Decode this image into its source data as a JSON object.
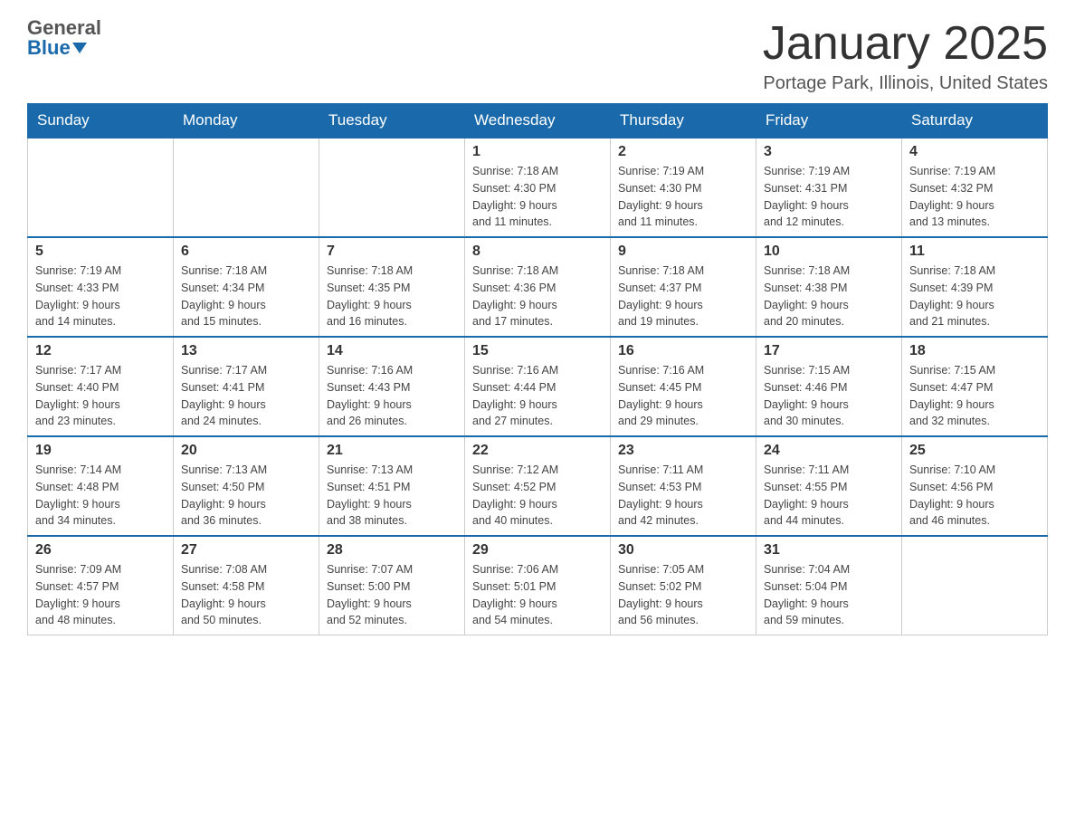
{
  "header": {
    "logo_general": "General",
    "logo_blue": "Blue",
    "month_title": "January 2025",
    "location": "Portage Park, Illinois, United States"
  },
  "days_of_week": [
    "Sunday",
    "Monday",
    "Tuesday",
    "Wednesday",
    "Thursday",
    "Friday",
    "Saturday"
  ],
  "weeks": [
    [
      {
        "day": "",
        "info": ""
      },
      {
        "day": "",
        "info": ""
      },
      {
        "day": "",
        "info": ""
      },
      {
        "day": "1",
        "info": "Sunrise: 7:18 AM\nSunset: 4:30 PM\nDaylight: 9 hours\nand 11 minutes."
      },
      {
        "day": "2",
        "info": "Sunrise: 7:19 AM\nSunset: 4:30 PM\nDaylight: 9 hours\nand 11 minutes."
      },
      {
        "day": "3",
        "info": "Sunrise: 7:19 AM\nSunset: 4:31 PM\nDaylight: 9 hours\nand 12 minutes."
      },
      {
        "day": "4",
        "info": "Sunrise: 7:19 AM\nSunset: 4:32 PM\nDaylight: 9 hours\nand 13 minutes."
      }
    ],
    [
      {
        "day": "5",
        "info": "Sunrise: 7:19 AM\nSunset: 4:33 PM\nDaylight: 9 hours\nand 14 minutes."
      },
      {
        "day": "6",
        "info": "Sunrise: 7:18 AM\nSunset: 4:34 PM\nDaylight: 9 hours\nand 15 minutes."
      },
      {
        "day": "7",
        "info": "Sunrise: 7:18 AM\nSunset: 4:35 PM\nDaylight: 9 hours\nand 16 minutes."
      },
      {
        "day": "8",
        "info": "Sunrise: 7:18 AM\nSunset: 4:36 PM\nDaylight: 9 hours\nand 17 minutes."
      },
      {
        "day": "9",
        "info": "Sunrise: 7:18 AM\nSunset: 4:37 PM\nDaylight: 9 hours\nand 19 minutes."
      },
      {
        "day": "10",
        "info": "Sunrise: 7:18 AM\nSunset: 4:38 PM\nDaylight: 9 hours\nand 20 minutes."
      },
      {
        "day": "11",
        "info": "Sunrise: 7:18 AM\nSunset: 4:39 PM\nDaylight: 9 hours\nand 21 minutes."
      }
    ],
    [
      {
        "day": "12",
        "info": "Sunrise: 7:17 AM\nSunset: 4:40 PM\nDaylight: 9 hours\nand 23 minutes."
      },
      {
        "day": "13",
        "info": "Sunrise: 7:17 AM\nSunset: 4:41 PM\nDaylight: 9 hours\nand 24 minutes."
      },
      {
        "day": "14",
        "info": "Sunrise: 7:16 AM\nSunset: 4:43 PM\nDaylight: 9 hours\nand 26 minutes."
      },
      {
        "day": "15",
        "info": "Sunrise: 7:16 AM\nSunset: 4:44 PM\nDaylight: 9 hours\nand 27 minutes."
      },
      {
        "day": "16",
        "info": "Sunrise: 7:16 AM\nSunset: 4:45 PM\nDaylight: 9 hours\nand 29 minutes."
      },
      {
        "day": "17",
        "info": "Sunrise: 7:15 AM\nSunset: 4:46 PM\nDaylight: 9 hours\nand 30 minutes."
      },
      {
        "day": "18",
        "info": "Sunrise: 7:15 AM\nSunset: 4:47 PM\nDaylight: 9 hours\nand 32 minutes."
      }
    ],
    [
      {
        "day": "19",
        "info": "Sunrise: 7:14 AM\nSunset: 4:48 PM\nDaylight: 9 hours\nand 34 minutes."
      },
      {
        "day": "20",
        "info": "Sunrise: 7:13 AM\nSunset: 4:50 PM\nDaylight: 9 hours\nand 36 minutes."
      },
      {
        "day": "21",
        "info": "Sunrise: 7:13 AM\nSunset: 4:51 PM\nDaylight: 9 hours\nand 38 minutes."
      },
      {
        "day": "22",
        "info": "Sunrise: 7:12 AM\nSunset: 4:52 PM\nDaylight: 9 hours\nand 40 minutes."
      },
      {
        "day": "23",
        "info": "Sunrise: 7:11 AM\nSunset: 4:53 PM\nDaylight: 9 hours\nand 42 minutes."
      },
      {
        "day": "24",
        "info": "Sunrise: 7:11 AM\nSunset: 4:55 PM\nDaylight: 9 hours\nand 44 minutes."
      },
      {
        "day": "25",
        "info": "Sunrise: 7:10 AM\nSunset: 4:56 PM\nDaylight: 9 hours\nand 46 minutes."
      }
    ],
    [
      {
        "day": "26",
        "info": "Sunrise: 7:09 AM\nSunset: 4:57 PM\nDaylight: 9 hours\nand 48 minutes."
      },
      {
        "day": "27",
        "info": "Sunrise: 7:08 AM\nSunset: 4:58 PM\nDaylight: 9 hours\nand 50 minutes."
      },
      {
        "day": "28",
        "info": "Sunrise: 7:07 AM\nSunset: 5:00 PM\nDaylight: 9 hours\nand 52 minutes."
      },
      {
        "day": "29",
        "info": "Sunrise: 7:06 AM\nSunset: 5:01 PM\nDaylight: 9 hours\nand 54 minutes."
      },
      {
        "day": "30",
        "info": "Sunrise: 7:05 AM\nSunset: 5:02 PM\nDaylight: 9 hours\nand 56 minutes."
      },
      {
        "day": "31",
        "info": "Sunrise: 7:04 AM\nSunset: 5:04 PM\nDaylight: 9 hours\nand 59 minutes."
      },
      {
        "day": "",
        "info": ""
      }
    ]
  ]
}
